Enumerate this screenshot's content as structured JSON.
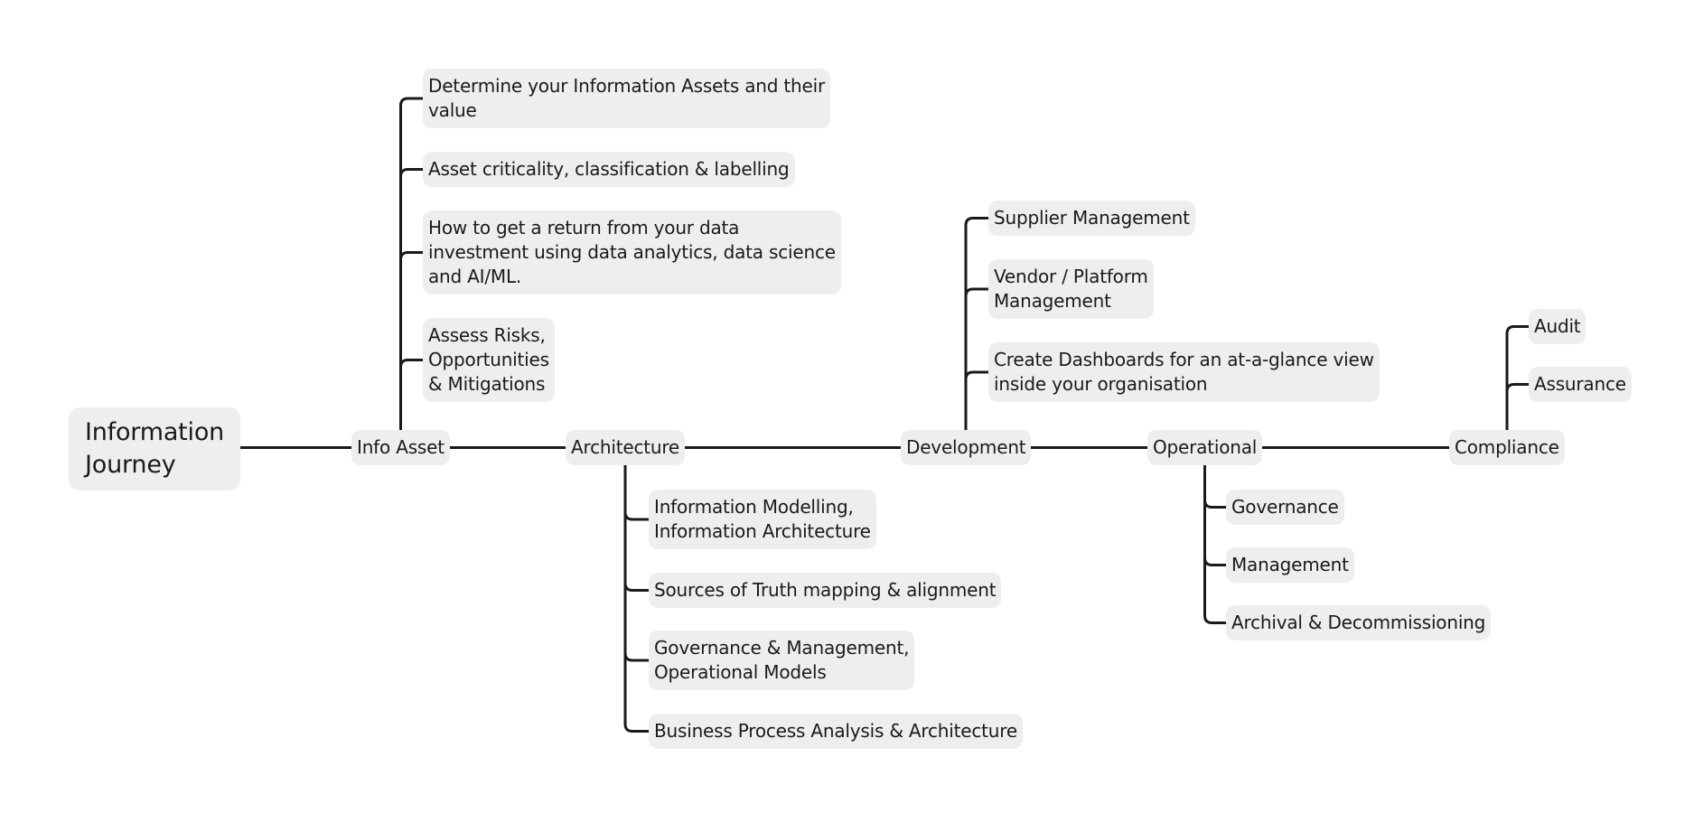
{
  "root": {
    "label": "Information\nJourney"
  },
  "branches": [
    {
      "label": "Info Asset",
      "direction": "up",
      "children": [
        "Determine your Information Assets and their\nvalue",
        "Asset criticality, classification & labelling",
        "How to get a return from your data\ninvestment using data analytics, data science\nand AI/ML.",
        "Assess Risks,\nOpportunities\n& Mitigations"
      ]
    },
    {
      "label": "Architecture",
      "direction": "down",
      "children": [
        "Information Modelling,\nInformation Architecture",
        "Sources of Truth mapping & alignment",
        "Governance & Management,\nOperational Models",
        "Business Process Analysis & Architecture"
      ]
    },
    {
      "label": "Development",
      "direction": "up",
      "children": [
        "Supplier Management",
        "Vendor / Platform\nManagement",
        "Create Dashboards for an at-a-glance view\ninside your organisation"
      ]
    },
    {
      "label": "Operational",
      "direction": "down",
      "children": [
        "Governance",
        "Management",
        "Archival & Decommissioning"
      ]
    },
    {
      "label": "Compliance",
      "direction": "up",
      "children": [
        "Audit",
        "Assurance"
      ]
    }
  ],
  "colors": {
    "node_fill": "#eeeeee",
    "line": "#1a1a1a",
    "text": "#1a1a1a"
  }
}
